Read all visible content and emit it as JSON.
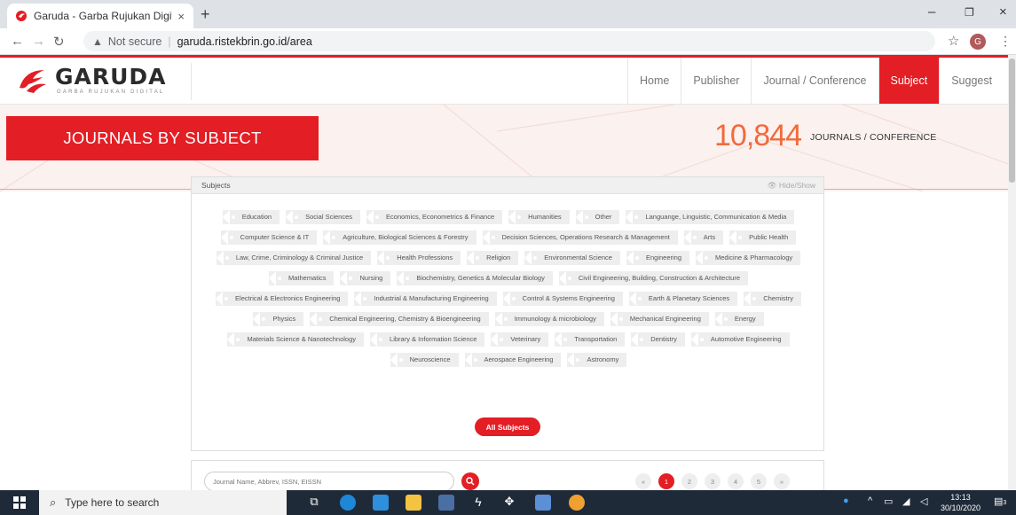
{
  "browser": {
    "tab_title": "Garuda - Garba Rujukan Digital",
    "tab_close": "×",
    "new_tab": "+",
    "minimize": "–",
    "restore": "❐",
    "close": "×",
    "security_label": "Not secure",
    "url": "garuda.ristekbrin.go.id/area",
    "profile_initial": "G"
  },
  "site": {
    "logo_name": "GARUDA",
    "logo_tagline": "GARBA RUJUKAN DIGITAL",
    "nav": [
      "Home",
      "Publisher",
      "Journal / Conference",
      "Subject",
      "Suggest"
    ],
    "active_nav": "Subject"
  },
  "hero": {
    "banner": "JOURNALS BY SUBJECT",
    "count": "10,844",
    "count_label": "JOURNALS / CONFERENCE"
  },
  "subjects_panel": {
    "title": "Subjects",
    "hide_show": "Hide/Show",
    "tags": [
      "Education",
      "Social Sciences",
      "Economics, Econometrics & Finance",
      "Humanities",
      "Other",
      "Languange, Linguistic, Communication & Media",
      "Computer Science & IT",
      "Agriculture, Biological Sciences & Forestry",
      "Decision Sciences, Operations Research & Management",
      "Arts",
      "Public Health",
      "Law, Crime, Criminology & Criminal Justice",
      "Health Professions",
      "Religion",
      "Environmental Science",
      "Engineering",
      "Medicine & Pharmacology",
      "Mathematics",
      "Nursing",
      "Biochemistry, Genetics & Molecular Biology",
      "Civil Engineering, Building, Construction & Architecture",
      "Electrical & Electronics Engineering",
      "Industrial & Manufacturing Engineering",
      "Control & Systems Engineering",
      "Earth & Planetary Sciences",
      "Chemistry",
      "Physics",
      "Chemical Engineering, Chemistry & Bioengineering",
      "Immunology & microbiology",
      "Mechanical Engineering",
      "Energy",
      "Materials Science & Nanotechnology",
      "Library & Information Science",
      "Veterinary",
      "Transportation",
      "Dentistry",
      "Automotive Engineering",
      "Neuroscience",
      "Aerospace Engineering",
      "Astronomy"
    ],
    "all_button": "All Subjects"
  },
  "search": {
    "placeholder": "Journal Name, Abbrev, ISSN, EISSN",
    "pages": [
      "«",
      "1",
      "2",
      "3",
      "4",
      "5",
      "»"
    ],
    "active_page": "1"
  },
  "taskbar": {
    "search_placeholder": "Type here to search",
    "time": "13:13",
    "date": "30/10/2020",
    "notifications": "3"
  },
  "colors": {
    "brand_red": "#e31e24",
    "count_orange": "#f26a3b",
    "hero_bg": "#fbf1ef"
  }
}
